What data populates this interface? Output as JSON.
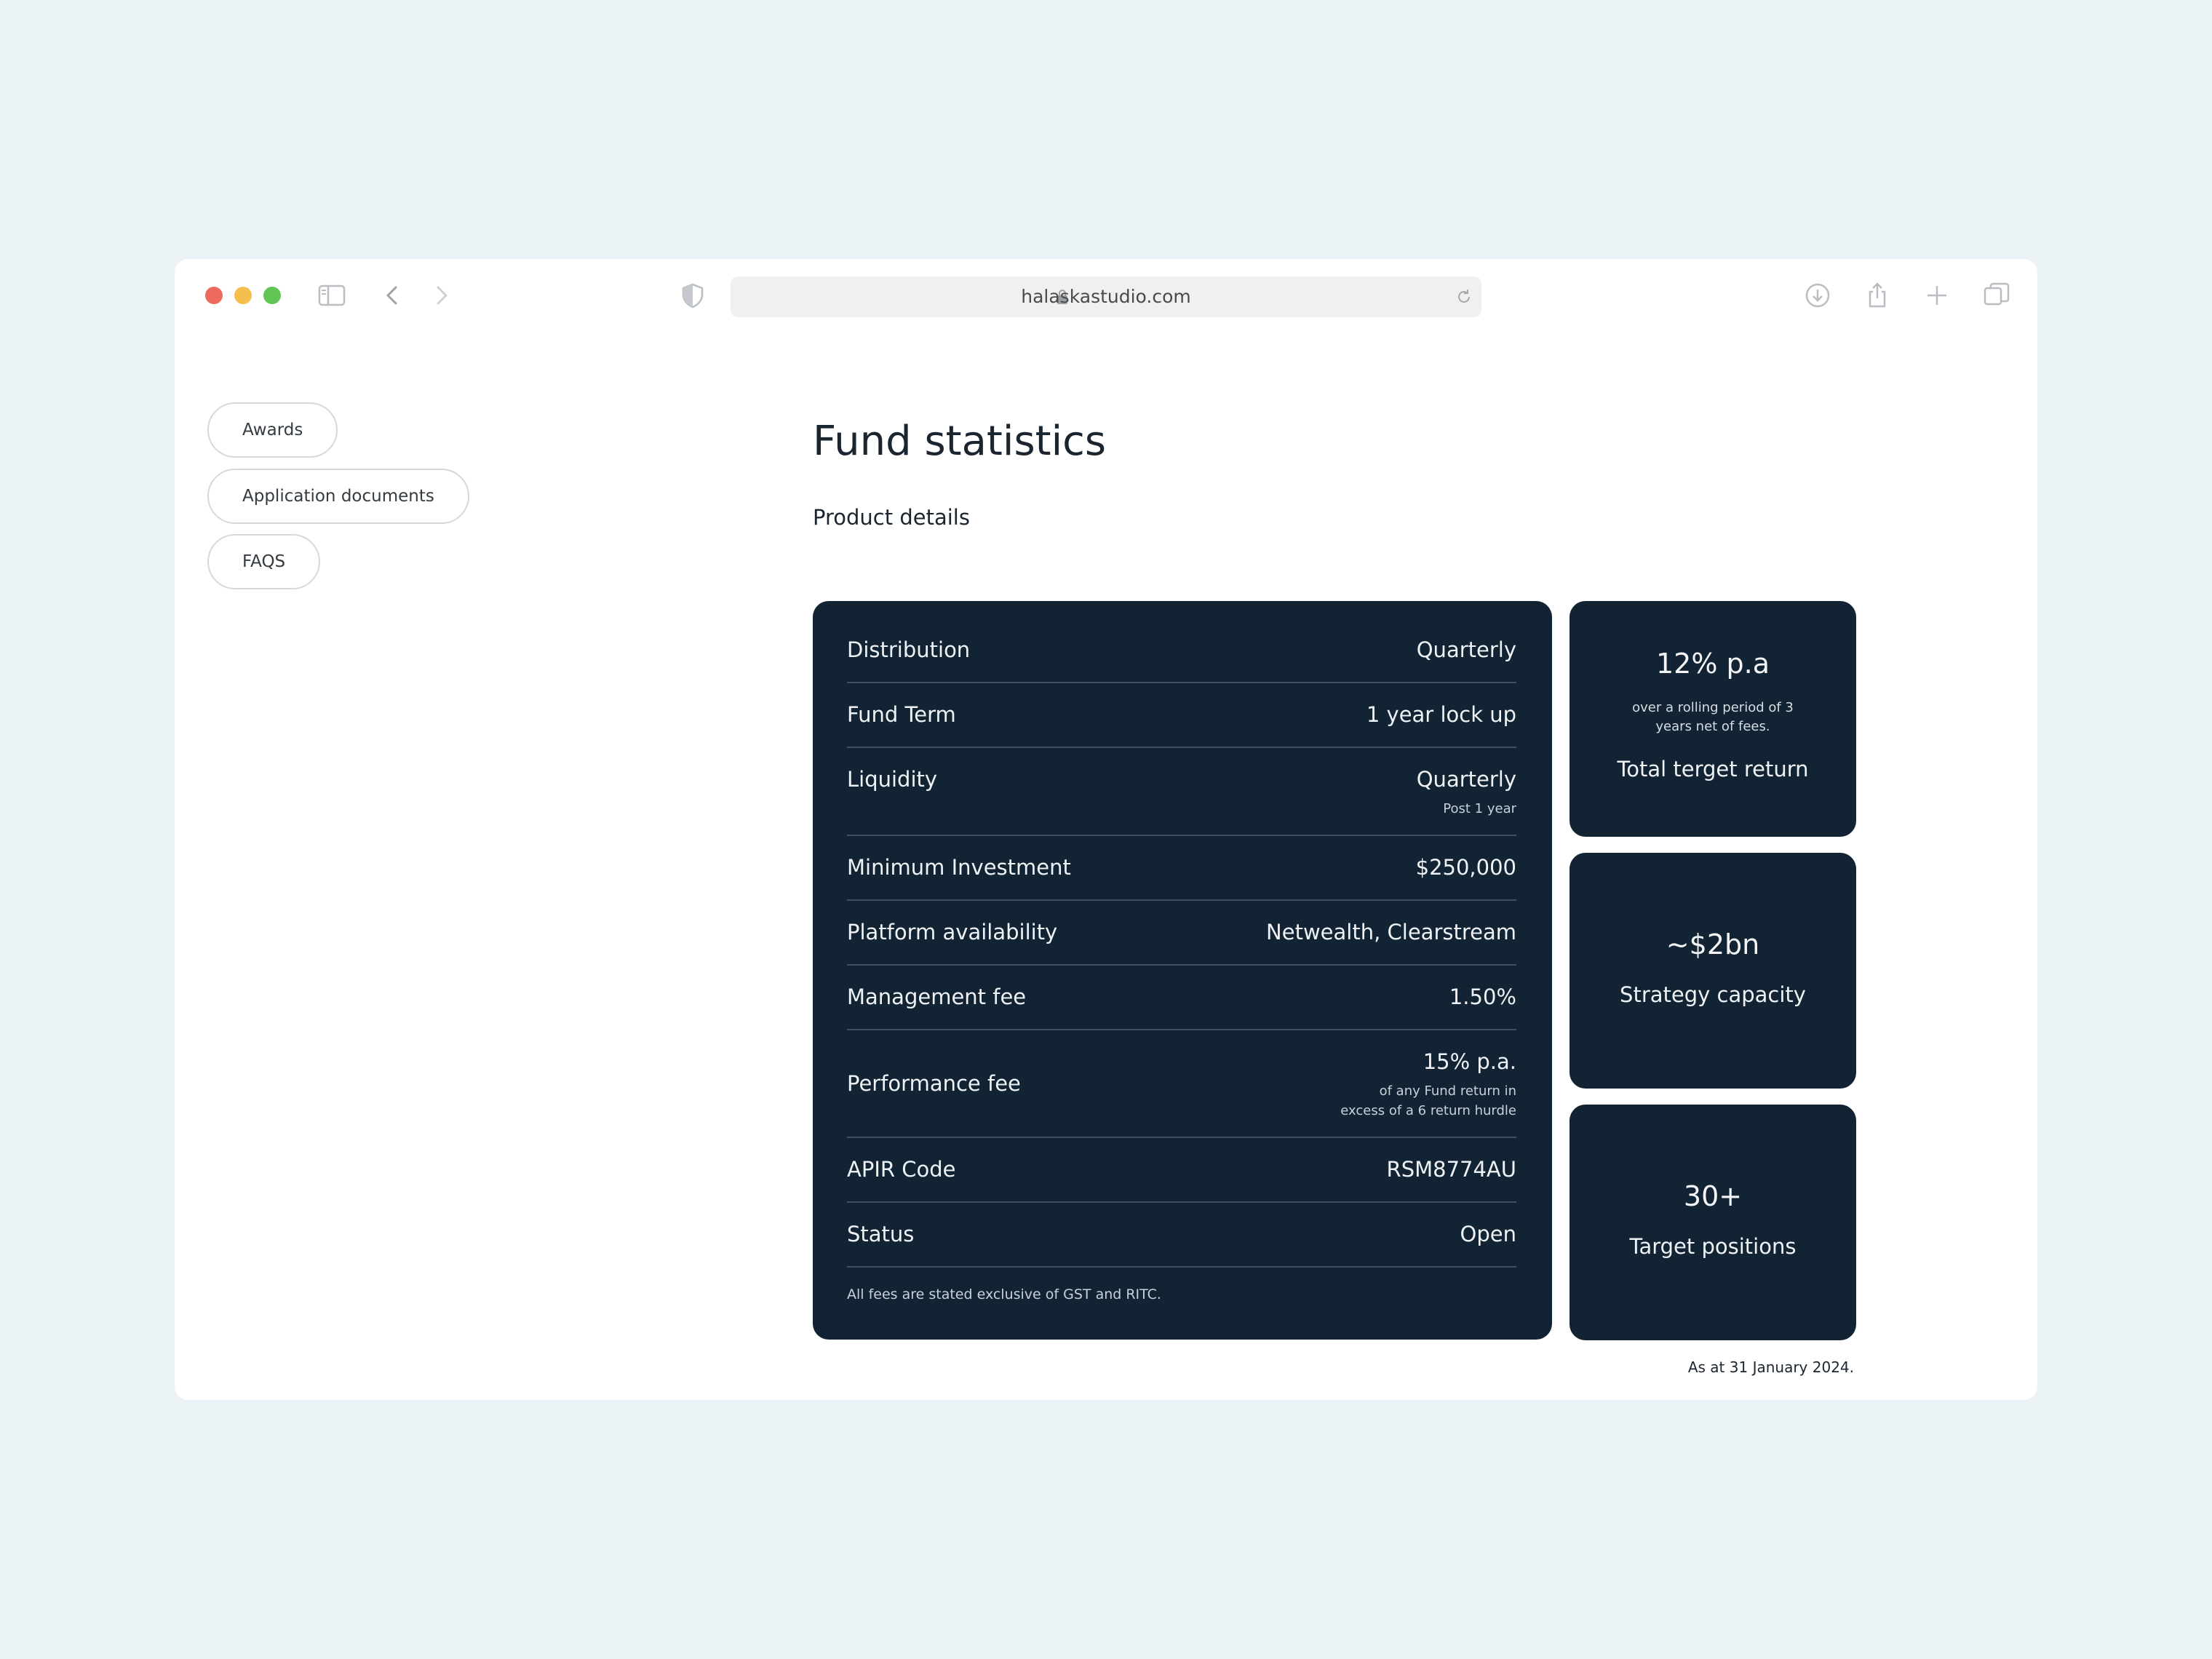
{
  "browser": {
    "url": "halaskastudio.com"
  },
  "sidebar": {
    "items": [
      {
        "label": "Awards"
      },
      {
        "label": "Application documents"
      },
      {
        "label": "FAQS"
      }
    ]
  },
  "main": {
    "title": "Fund statistics",
    "subtitle": "Product details",
    "rows": [
      {
        "label": "Distribution",
        "value": "Quarterly"
      },
      {
        "label": "Fund Term",
        "value": "1 year lock up"
      },
      {
        "label": "Liquidity",
        "value": "Quarterly",
        "note": "Post 1 year"
      },
      {
        "label": "Minimum Investment",
        "value": "$250,000"
      },
      {
        "label": "Platform availability",
        "value": "Netwealth, Clearstream"
      },
      {
        "label": "Management fee",
        "value": "1.50%"
      },
      {
        "label": "Performance fee",
        "value": "15% p.a.",
        "note_line1": "of any Fund return in",
        "note_line2": "excess of a 6 return hurdle"
      },
      {
        "label": "APIR Code",
        "value": "RSM8774AU"
      },
      {
        "label": "Status",
        "value": "Open"
      }
    ],
    "footnote": "All fees are stated exclusive of GST and RITC.",
    "cards": [
      {
        "value": "12% p.a",
        "detail": "over a rolling period of 3 years net of fees.",
        "caption": "Total terget return"
      },
      {
        "value": "~$2bn",
        "caption": "Strategy capacity"
      },
      {
        "value": "30+",
        "caption": "Target positions"
      }
    ],
    "as_at": "As at 31 January 2024."
  },
  "colors": {
    "page_bg": "#eaf2f5",
    "panel_bg": "#122333",
    "close": "#ed6a5e",
    "minimize": "#f4bf4f",
    "zoom": "#61c554"
  },
  "icons": [
    "sidebar-toggle-icon",
    "back-icon",
    "forward-icon",
    "shield-icon",
    "lock-icon",
    "reload-icon",
    "download-icon",
    "share-icon",
    "new-tab-icon",
    "tabs-overview-icon"
  ]
}
